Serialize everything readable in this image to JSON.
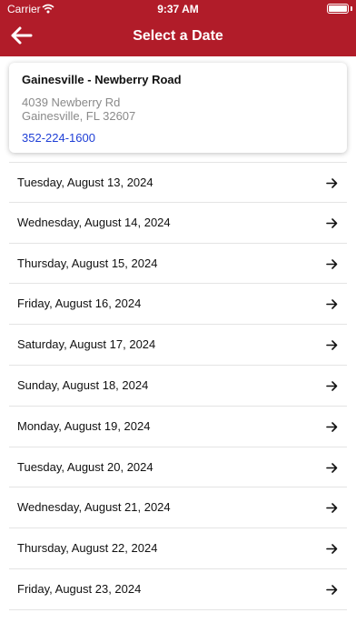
{
  "status_bar": {
    "carrier": "Carrier",
    "time": "9:37 AM",
    "battery_level": 1.0
  },
  "header": {
    "title": "Select a Date",
    "back_icon": "arrow-left-icon",
    "color": "#b11c29"
  },
  "store": {
    "name": "Gainesville - Newberry Road",
    "address_line1": "4039 Newberry Rd",
    "address_line2": "Gainesville, FL 32607",
    "phone": "352-224-1600",
    "phone_color": "#1f3fd6"
  },
  "dates": [
    {
      "label": "Tuesday, August 13, 2024"
    },
    {
      "label": "Wednesday, August 14, 2024"
    },
    {
      "label": "Thursday, August 15, 2024"
    },
    {
      "label": "Friday, August 16, 2024"
    },
    {
      "label": "Saturday, August 17, 2024"
    },
    {
      "label": "Sunday, August 18, 2024"
    },
    {
      "label": "Monday, August 19, 2024"
    },
    {
      "label": "Tuesday, August 20, 2024"
    },
    {
      "label": "Wednesday, August 21, 2024"
    },
    {
      "label": "Thursday, August 22, 2024"
    },
    {
      "label": "Friday, August 23, 2024"
    }
  ],
  "row_icon": "arrow-right-icon"
}
